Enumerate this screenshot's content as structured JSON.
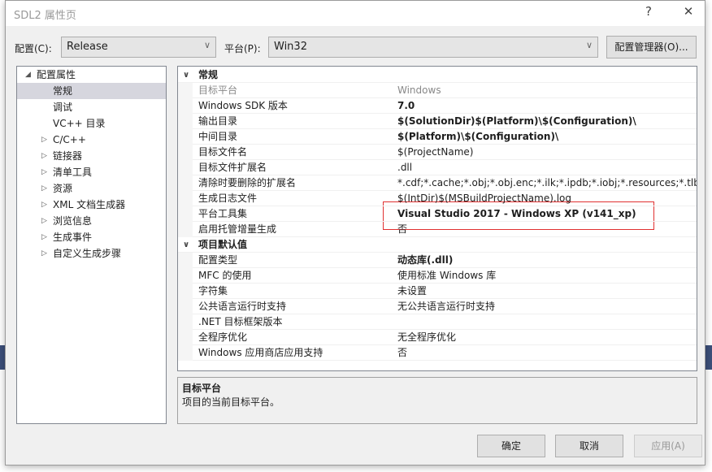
{
  "title": "SDL2 属性页",
  "help_label": "?",
  "close_label": "✕",
  "config": {
    "label": "配置(C):",
    "value": "Release",
    "platform_label": "平台(P):",
    "platform_value": "Win32",
    "manager_button": "配置管理器(O)..."
  },
  "tree": [
    {
      "label": "配置属性",
      "expander": "◢",
      "expanded": true
    },
    {
      "label": "常规",
      "selected": true
    },
    {
      "label": "调试"
    },
    {
      "label": "VC++ 目录"
    },
    {
      "label": "C/C++",
      "expander": "▷"
    },
    {
      "label": "链接器",
      "expander": "▷"
    },
    {
      "label": "清单工具",
      "expander": "▷"
    },
    {
      "label": "资源",
      "expander": "▷"
    },
    {
      "label": "XML 文档生成器",
      "expander": "▷"
    },
    {
      "label": "浏览信息",
      "expander": "▷"
    },
    {
      "label": "生成事件",
      "expander": "▷"
    },
    {
      "label": "自定义生成步骤",
      "expander": "▷"
    }
  ],
  "grid": {
    "sections": [
      {
        "title": "常规",
        "rows": [
          {
            "name": "目标平台",
            "value": "Windows",
            "style": "gray"
          },
          {
            "name": "Windows SDK 版本",
            "value": "7.0",
            "style": "bold"
          },
          {
            "name": "输出目录",
            "value": "$(SolutionDir)$(Platform)\\$(Configuration)\\",
            "style": "bold"
          },
          {
            "name": "中间目录",
            "value": "$(Platform)\\$(Configuration)\\",
            "style": "bold"
          },
          {
            "name": "目标文件名",
            "value": "$(ProjectName)"
          },
          {
            "name": "目标文件扩展名",
            "value": ".dll"
          },
          {
            "name": "清除时要删除的扩展名",
            "value": "*.cdf;*.cache;*.obj;*.obj.enc;*.ilk;*.ipdb;*.iobj;*.resources;*.tlb;*.tli;*.tlh;*.tmp"
          },
          {
            "name": "生成日志文件",
            "value": "$(IntDir)$(MSBuildProjectName).log"
          },
          {
            "name": "平台工具集",
            "value": "Visual Studio 2017 - Windows XP (v141_xp)",
            "style": "bold"
          },
          {
            "name": "启用托管增量生成",
            "value": "否"
          }
        ]
      },
      {
        "title": "项目默认值",
        "rows": [
          {
            "name": "配置类型",
            "value": "动态库(.dll)",
            "style": "bold"
          },
          {
            "name": "MFC 的使用",
            "value": "使用标准 Windows 库"
          },
          {
            "name": "字符集",
            "value": "未设置"
          },
          {
            "name": "公共语言运行时支持",
            "value": "无公共语言运行时支持"
          },
          {
            "name": ".NET 目标框架版本",
            "value": ""
          },
          {
            "name": "全程序优化",
            "value": "无全程序优化"
          },
          {
            "name": "Windows 应用商店应用支持",
            "value": "否"
          }
        ]
      }
    ],
    "chevron": "∨"
  },
  "description": {
    "title": "目标平台",
    "text": "项目的当前目标平台。"
  },
  "buttons": {
    "ok": "确定",
    "cancel": "取消",
    "apply": "应用(A)"
  },
  "colors": {
    "highlight_box": "#e03030",
    "selected_item": "#d6d6de"
  }
}
